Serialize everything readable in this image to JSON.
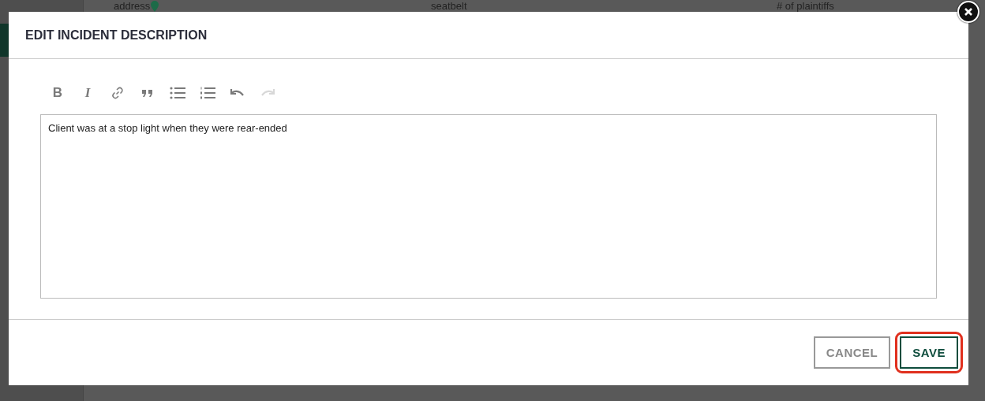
{
  "background": {
    "columns": [
      "address",
      "seatbelt",
      "# of plaintiffs"
    ]
  },
  "dialog": {
    "title": "EDIT INCIDENT DESCRIPTION",
    "toolbar": [
      {
        "kind": "bold",
        "glyph": "B",
        "disabled": false
      },
      {
        "kind": "italic",
        "glyph": "I",
        "disabled": false
      },
      {
        "kind": "link",
        "disabled": false
      },
      {
        "kind": "quote",
        "disabled": false
      },
      {
        "kind": "bullets",
        "disabled": false
      },
      {
        "kind": "numbers",
        "disabled": false
      },
      {
        "kind": "undo",
        "disabled": false
      },
      {
        "kind": "redo",
        "disabled": true
      }
    ],
    "editor": {
      "value": "Client was at a stop light when they were rear-ended"
    },
    "buttons": [
      {
        "label": "CANCEL",
        "kind": "secondary",
        "highlighted": false
      },
      {
        "label": "SAVE",
        "kind": "primary",
        "highlighted": true
      }
    ]
  }
}
